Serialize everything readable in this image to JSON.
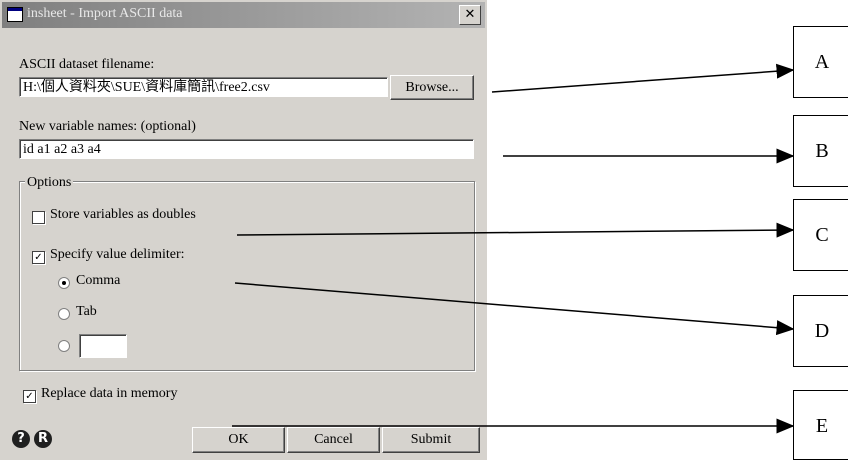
{
  "window": {
    "title": "insheet - Import ASCII data",
    "close_symbol": "✕"
  },
  "filename": {
    "label": "ASCII dataset filename:",
    "value": "H:\\個人資料夾\\SUE\\資料庫簡訊\\free2.csv",
    "browse_label": "Browse..."
  },
  "varnames": {
    "label": "New variable names: (optional)",
    "value": "id a1 a2 a3 a4"
  },
  "options": {
    "legend": "Options",
    "store_doubles": {
      "label": "Store variables as doubles",
      "checked": false
    },
    "specify_delim": {
      "label": "Specify value delimiter:",
      "checked": true
    },
    "delimiters": [
      {
        "label": "Comma",
        "selected": true
      },
      {
        "label": "Tab",
        "selected": false
      },
      {
        "label": "",
        "selected": false
      }
    ],
    "custom_delim_value": ""
  },
  "replace": {
    "label": "Replace data in memory",
    "checked": true
  },
  "buttons": {
    "ok": "OK",
    "cancel": "Cancel",
    "submit": "Submit"
  },
  "footer_icons": {
    "help": "?",
    "reset": "R",
    "help_name": "help-icon",
    "reset_name": "reset-icon"
  },
  "annotations": [
    "A",
    "B",
    "C",
    "D",
    "E"
  ]
}
